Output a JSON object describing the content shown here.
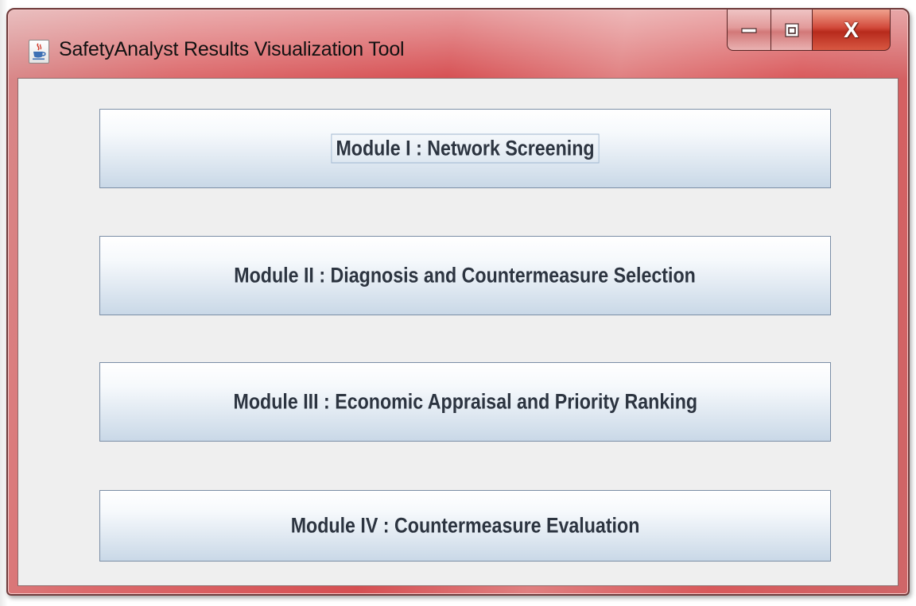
{
  "window": {
    "title": "SafetyAnalyst Results Visualization Tool",
    "icon": "java-cup-icon",
    "controls": {
      "minimize_icon": "minimize-icon",
      "maximize_icon": "maximize-icon",
      "close_label": "X"
    }
  },
  "modules": [
    {
      "label": "Module I : Network Screening",
      "focused": true
    },
    {
      "label": "Module II : Diagnosis and Countermeasure Selection",
      "focused": false
    },
    {
      "label": "Module III : Economic Appraisal and Priority Ranking",
      "focused": false
    },
    {
      "label": "Module IV : Countermeasure Evaluation",
      "focused": false
    }
  ],
  "colors": {
    "title_bar": "#d64f52",
    "content_bg": "#efefef",
    "button_text": "#2c3440",
    "close_button": "#c43a2b"
  }
}
